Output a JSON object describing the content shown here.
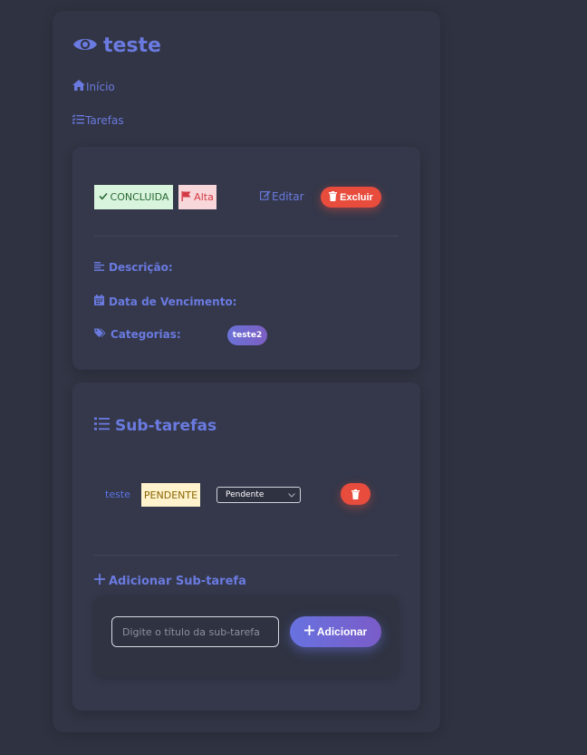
{
  "header": {
    "title": "teste"
  },
  "nav": {
    "home": "Início",
    "tasks": "Tarefas"
  },
  "task": {
    "status": "CONCLUIDA",
    "priority": "Alta",
    "edit_label": "Editar",
    "delete_label": "Excluir",
    "description_label": "Descrição:",
    "due_label": "Data de Vencimento:",
    "categories_label": "Categorias:",
    "categories": [
      "teste2"
    ]
  },
  "subtasks": {
    "title": "Sub-tarefas",
    "items": [
      {
        "title": "teste",
        "status": "PENDENTE",
        "select_value": "Pendente"
      }
    ],
    "add_title": "Adicionar Sub-tarefa",
    "input_placeholder": "Digite o título da sub-tarefa",
    "add_button": "Adicionar"
  },
  "colors": {
    "background": "#2f3241",
    "accent": "#6a7ae0",
    "danger": "#e84c3d",
    "success_bg": "#d9f4dd",
    "warning_bg": "#fff3cd"
  },
  "icons": {
    "title": "eye-icon",
    "home": "home-icon",
    "tasks": "task-list-icon",
    "status": "check-icon",
    "priority": "flag-icon",
    "edit": "edit-icon",
    "delete": "trash-icon",
    "description": "align-left-icon",
    "due": "calendar-icon",
    "categories": "tags-icon",
    "subtasks": "list-icon",
    "add": "plus-icon"
  }
}
